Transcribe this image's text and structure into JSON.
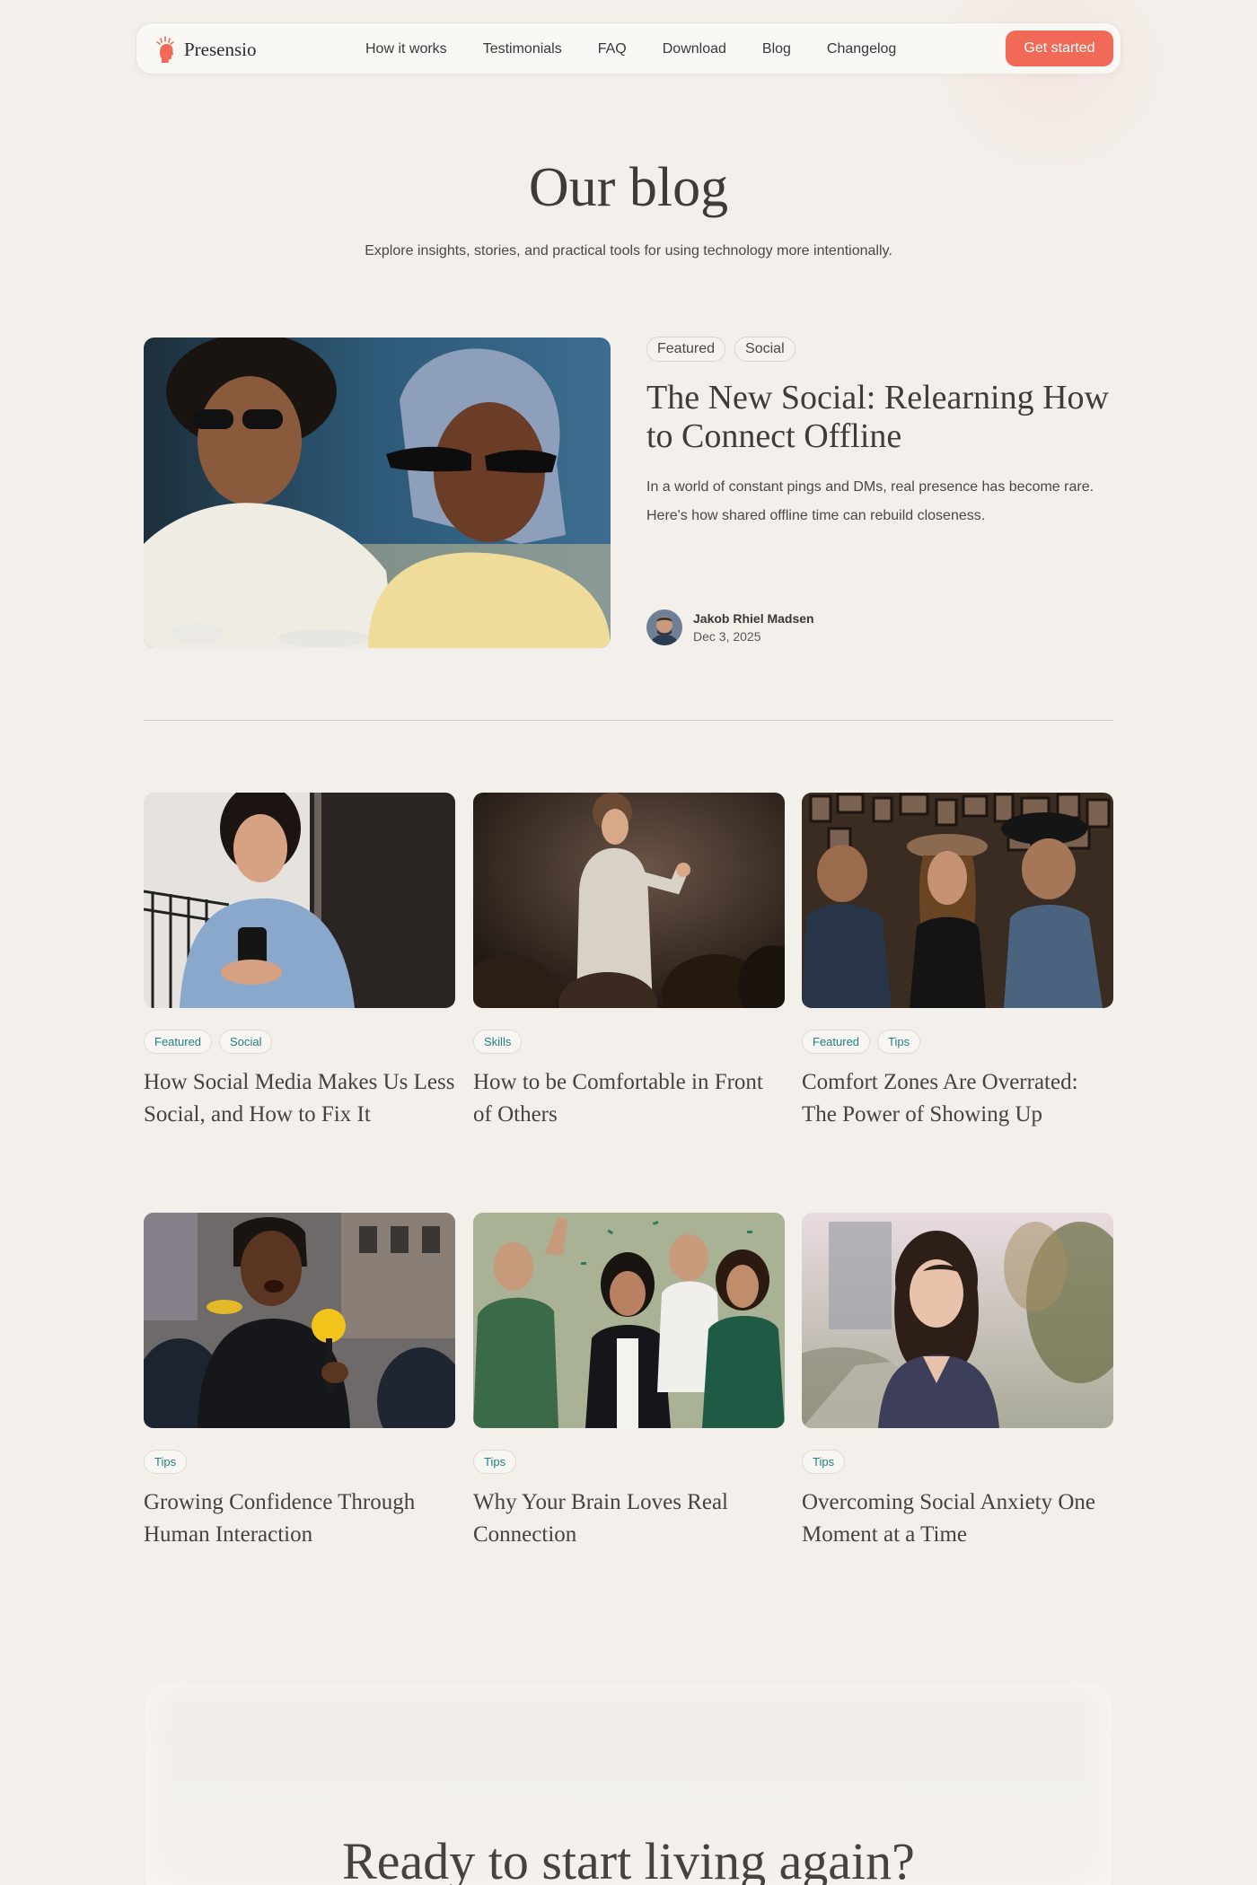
{
  "brand": {
    "name": "Presensio",
    "accent": "#f16a58",
    "tag_text_color": "#1f7f85"
  },
  "nav": {
    "links": [
      "How it works",
      "Testimonials",
      "FAQ",
      "Download",
      "Blog",
      "Changelog"
    ],
    "cta_label": "Get started"
  },
  "hero": {
    "title": "Our blog",
    "subtitle": "Explore insights, stories, and practical tools for using technology more intentionally."
  },
  "featured": {
    "image": "two-women-in-sunglasses-photo",
    "tags": [
      "Featured",
      "Social"
    ],
    "title": "The New Social: Relearning How to Connect Offline",
    "excerpt": "In a world of constant pings and DMs, real presence has become rare. Here's how shared offline time can rebuild closeness.",
    "author": {
      "name": "Jakob Rhiel Madsen",
      "date": "Dec 3, 2025"
    }
  },
  "posts": [
    {
      "image": "woman-smiling-at-phone-photo",
      "tags": [
        "Featured",
        "Social"
      ],
      "title": "How Social Media Makes Us Less Social, and How to Fix It"
    },
    {
      "image": "speaker-on-stage-photo",
      "tags": [
        "Skills"
      ],
      "title": "How to be Comfortable in Front of Others"
    },
    {
      "image": "friends-at-gallery-photo",
      "tags": [
        "Featured",
        "Tips"
      ],
      "title": "Comfort Zones Are Overrated: The Power of Showing Up"
    },
    {
      "image": "man-with-microphone-photo",
      "tags": [
        "Tips"
      ],
      "title": "Growing Confidence Through Human Interaction"
    },
    {
      "image": "friends-celebrating-photo",
      "tags": [
        "Tips"
      ],
      "title": "Why Your Brain Loves Real Connection"
    },
    {
      "image": "woman-in-park-photo",
      "tags": [
        "Tips"
      ],
      "title": "Overcoming Social Anxiety One Moment at a Time"
    }
  ],
  "cta_section": {
    "title": "Ready to start living again?"
  }
}
